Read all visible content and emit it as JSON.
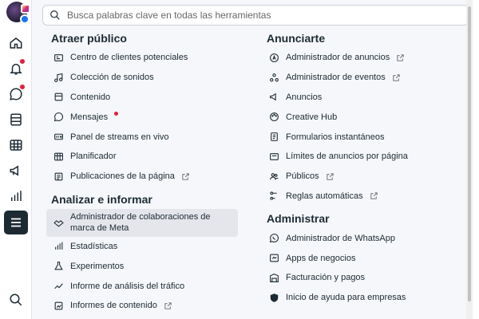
{
  "search": {
    "placeholder": "Busca palabras clave en todas las herramientas"
  },
  "rail": {
    "items": [
      "home-icon",
      "bell-icon",
      "chat-icon",
      "pages-icon",
      "table-icon",
      "megaphone-icon",
      "bars-chart-icon",
      "menu-icon",
      "search-icon"
    ]
  },
  "left": {
    "sections": [
      {
        "title": "Atraer público",
        "items": [
          {
            "label": "Centro de clientes potenciales",
            "icon": "leads-icon"
          },
          {
            "label": "Colección de sonidos",
            "icon": "music-icon"
          },
          {
            "label": "Contenido",
            "icon": "content-icon"
          },
          {
            "label": "Mensajes",
            "icon": "message-icon"
          },
          {
            "label": "Panel de streams en vivo",
            "icon": "live-icon"
          },
          {
            "label": "Planificador",
            "icon": "calendar-icon"
          },
          {
            "label": "Publicaciones de la página",
            "icon": "page-posts-icon"
          }
        ]
      },
      {
        "title": "Analizar e informar",
        "items": [
          {
            "label": "Administrador de colaboraciones de marca de Meta",
            "icon": "handshake-icon"
          },
          {
            "label": "Estadísticas",
            "icon": "stats-icon"
          },
          {
            "label": "Experimentos",
            "icon": "flask-icon"
          },
          {
            "label": "Informe de análisis del tráfico",
            "icon": "traffic-icon"
          },
          {
            "label": "Informes de contenido",
            "icon": "report-icon"
          }
        ]
      }
    ]
  },
  "right": {
    "sections": [
      {
        "title": "Anunciarte",
        "items": [
          {
            "label": "Administrador de anuncios",
            "icon": "ads-manager-icon"
          },
          {
            "label": "Administrador de eventos",
            "icon": "events-icon"
          },
          {
            "label": "Anuncios",
            "icon": "megaphone-icon"
          },
          {
            "label": "Creative Hub",
            "icon": "palette-icon"
          },
          {
            "label": "Formularios instantáneos",
            "icon": "form-icon"
          },
          {
            "label": "Límites de anuncios por página",
            "icon": "limit-icon"
          },
          {
            "label": "Públicos",
            "icon": "audience-icon"
          },
          {
            "label": "Reglas automáticas",
            "icon": "rules-icon"
          }
        ]
      },
      {
        "title": "Administrar",
        "items": [
          {
            "label": "Administrador de WhatsApp",
            "icon": "whatsapp-icon"
          },
          {
            "label": "Apps de negocios",
            "icon": "apps-icon"
          },
          {
            "label": "Facturación y pagos",
            "icon": "billing-icon"
          },
          {
            "label": "Inicio de ayuda para empresas",
            "icon": "help-shield-icon"
          }
        ]
      }
    ]
  },
  "colors": {
    "accent_dot": "#e41e3f",
    "highlight": "#e4e6eb",
    "rail_active": "#1c2b33"
  }
}
